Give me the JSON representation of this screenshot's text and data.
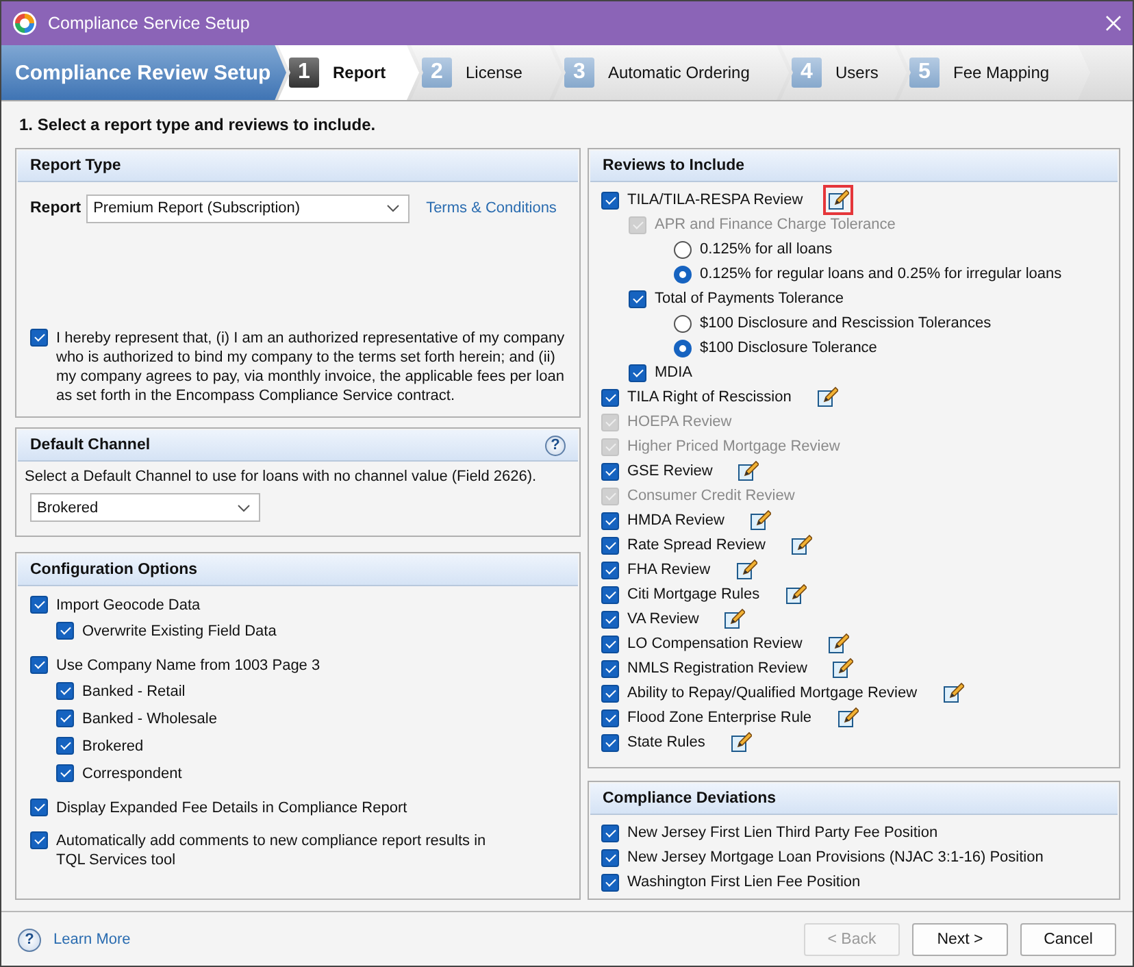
{
  "window": {
    "title": "Compliance Service Setup"
  },
  "wizard": {
    "title": "Compliance Review Setup",
    "steps": [
      {
        "number": "1",
        "label": "Report",
        "selected": true
      },
      {
        "number": "2",
        "label": "License",
        "selected": false
      },
      {
        "number": "3",
        "label": "Automatic Ordering",
        "selected": false
      },
      {
        "number": "4",
        "label": "Users",
        "selected": false
      },
      {
        "number": "5",
        "label": "Fee Mapping",
        "selected": false
      }
    ]
  },
  "instruction": "1. Select a report type and reviews to include.",
  "report_type": {
    "title": "Report Type",
    "report_label": "Report",
    "report_value": "Premium Report (Subscription)",
    "terms_link": "Terms & Conditions",
    "agreement": {
      "text": "I hereby represent that, (i) I am an authorized representative of my company who is authorized to bind my company to the terms set forth herein; and (ii) my company agrees to pay, via monthly invoice, the applicable fees per loan as set forth in the Encompass Compliance Service contract.",
      "checked": true
    }
  },
  "default_channel": {
    "title": "Default Channel",
    "help": "?",
    "description": "Select a Default Channel to use for loans with no channel value (Field 2626).",
    "value": "Brokered"
  },
  "configuration_options": {
    "title": "Configuration Options",
    "options": [
      {
        "label": "Import Geocode Data",
        "checked": true,
        "children": [
          {
            "label": "Overwrite Existing Field Data",
            "checked": true
          }
        ]
      },
      {
        "label": "Use Company Name from 1003 Page 3",
        "checked": true,
        "children": [
          {
            "label": "Banked - Retail",
            "checked": true
          },
          {
            "label": "Banked - Wholesale",
            "checked": true
          },
          {
            "label": "Brokered",
            "checked": true
          },
          {
            "label": "Correspondent",
            "checked": true
          }
        ]
      },
      {
        "label": "Display Expanded Fee Details in Compliance Report",
        "checked": true
      },
      {
        "label": "Automatically add comments to new compliance report results in TQL Services tool",
        "checked": true
      }
    ]
  },
  "reviews": {
    "title": "Reviews to Include",
    "items": [
      {
        "label": "TILA/TILA-RESPA Review",
        "checked": true,
        "disabled": false,
        "editable": true,
        "highlighted": true,
        "children": [
          {
            "label": "APR and Finance Charge Tolerance",
            "checked": true,
            "disabled": true,
            "options": [
              {
                "label": "0.125% for all loans",
                "selected": false
              },
              {
                "label": "0.125% for regular loans and 0.25% for irregular loans",
                "selected": true
              }
            ]
          },
          {
            "label": "Total of Payments Tolerance",
            "checked": true,
            "disabled": false,
            "options": [
              {
                "label": "$100 Disclosure and Rescission Tolerances",
                "selected": false
              },
              {
                "label": "$100 Disclosure Tolerance",
                "selected": true
              }
            ]
          },
          {
            "label": "MDIA",
            "checked": true,
            "disabled": false
          }
        ]
      },
      {
        "label": "TILA Right of Rescission",
        "checked": true,
        "disabled": false,
        "editable": true
      },
      {
        "label": "HOEPA Review",
        "checked": true,
        "disabled": true
      },
      {
        "label": "Higher Priced Mortgage Review",
        "checked": true,
        "disabled": true
      },
      {
        "label": "GSE Review",
        "checked": true,
        "disabled": false,
        "editable": true
      },
      {
        "label": "Consumer Credit Review",
        "checked": true,
        "disabled": true
      },
      {
        "label": "HMDA Review",
        "checked": true,
        "disabled": false,
        "editable": true
      },
      {
        "label": "Rate Spread Review",
        "checked": true,
        "disabled": false,
        "editable": true
      },
      {
        "label": "FHA Review",
        "checked": true,
        "disabled": false,
        "editable": true
      },
      {
        "label": "Citi Mortgage Rules",
        "checked": true,
        "disabled": false,
        "editable": true
      },
      {
        "label": "VA Review",
        "checked": true,
        "disabled": false,
        "editable": true
      },
      {
        "label": "LO Compensation Review",
        "checked": true,
        "disabled": false,
        "editable": true
      },
      {
        "label": "NMLS Registration Review",
        "checked": true,
        "disabled": false,
        "editable": true
      },
      {
        "label": "Ability to Repay/Qualified Mortgage Review",
        "checked": true,
        "disabled": false,
        "editable": true
      },
      {
        "label": "Flood Zone Enterprise Rule",
        "checked": true,
        "disabled": false,
        "editable": true
      },
      {
        "label": "State Rules",
        "checked": true,
        "disabled": false,
        "editable": true
      }
    ]
  },
  "compliance_deviations": {
    "title": "Compliance Deviations",
    "items": [
      {
        "label": "New Jersey First Lien Third Party Fee Position",
        "checked": true
      },
      {
        "label": "New Jersey Mortgage Loan Provisions (NJAC 3:1-16) Position",
        "checked": true
      },
      {
        "label": "Washington First Lien Fee Position",
        "checked": true
      }
    ]
  },
  "footer": {
    "help": "?",
    "learn_more": "Learn More",
    "buttons": [
      {
        "label": "< Back",
        "disabled": true
      },
      {
        "label": "Next >",
        "disabled": false
      },
      {
        "label": "Cancel",
        "disabled": false
      }
    ]
  }
}
